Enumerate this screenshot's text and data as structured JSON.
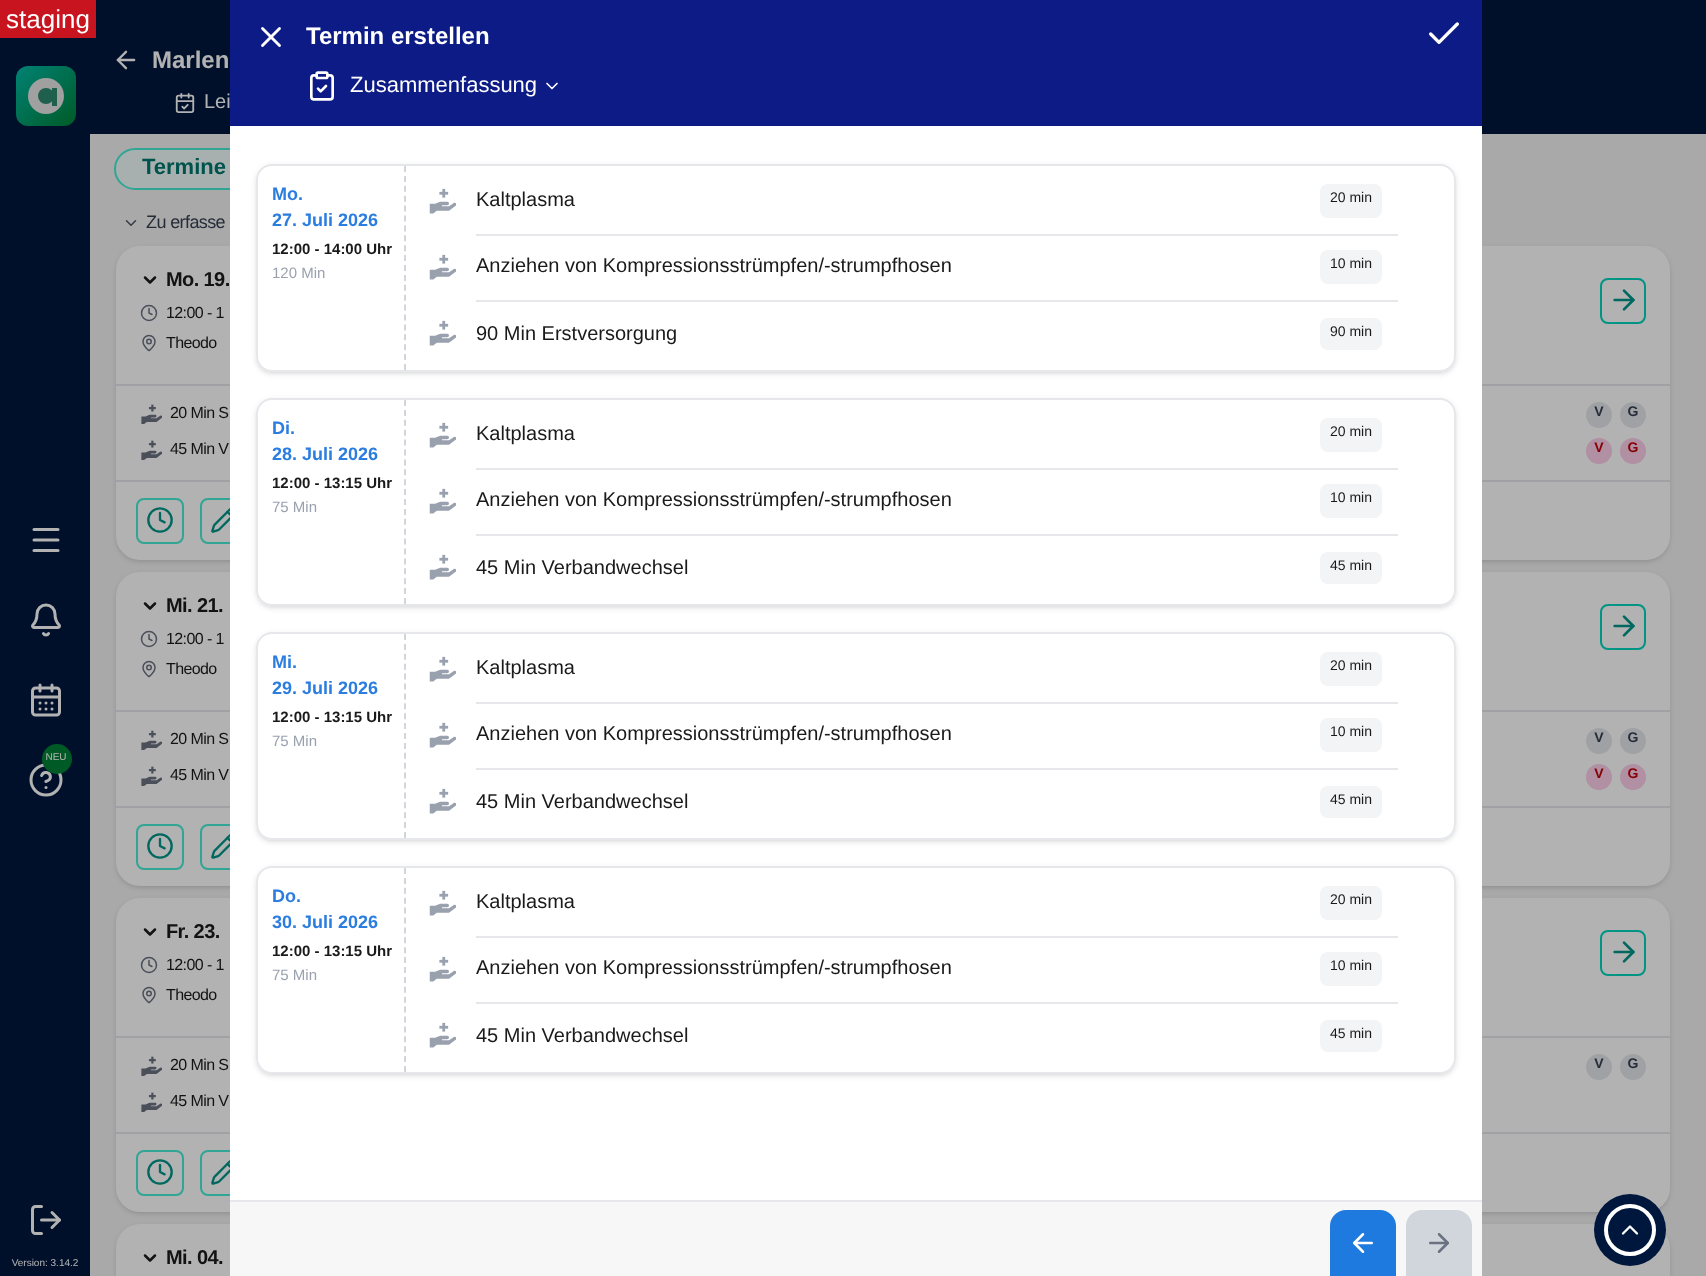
{
  "environment_badge": "staging",
  "sidebar": {
    "help_badge": "NEU",
    "version": "Version: 3.14.2"
  },
  "header": {
    "title": "Marlen",
    "subtitle": "Lei"
  },
  "tabs": [
    {
      "label": "Termine",
      "selected": true
    }
  ],
  "section": {
    "label": "Zu erfasse",
    "expanded": true
  },
  "appointments": [
    {
      "date": "Mo. 19.",
      "expanded": true,
      "time": "12:00 - 1",
      "place": "Theodo",
      "services": [
        {
          "label": "20 Min S",
          "badges": [
            {
              "label": "V",
              "alert": false
            },
            {
              "label": "G",
              "alert": false
            }
          ]
        },
        {
          "label": "45 Min V",
          "badges": [
            {
              "label": "V",
              "alert": true
            },
            {
              "label": "G",
              "alert": true
            }
          ]
        }
      ]
    },
    {
      "date": "Mi. 21.",
      "expanded": true,
      "time": "12:00 - 1",
      "place": "Theodo",
      "services": [
        {
          "label": "20 Min S",
          "badges": [
            {
              "label": "V",
              "alert": false
            },
            {
              "label": "G",
              "alert": false
            }
          ]
        },
        {
          "label": "45 Min V",
          "badges": [
            {
              "label": "V",
              "alert": true
            },
            {
              "label": "G",
              "alert": true
            }
          ]
        }
      ]
    },
    {
      "date": "Fr. 23.",
      "expanded": true,
      "time": "12:00 - 1",
      "place": "Theodo",
      "services": [
        {
          "label": "20 Min S",
          "badges": [
            {
              "label": "V",
              "alert": false
            },
            {
              "label": "G",
              "alert": false
            }
          ]
        },
        {
          "label": "45 Min V"
        }
      ]
    },
    {
      "date": "Mi. 04.",
      "expanded": true
    }
  ],
  "modal": {
    "title": "Termin erstellen",
    "step": "Zusammenfassung",
    "days": [
      {
        "weekday": "Mo.",
        "date": "27. Juli 2026",
        "time": "12:00 - 14:00 Uhr",
        "duration": "120 Min",
        "services": [
          {
            "label": "Kaltplasma",
            "minutes": "20 min"
          },
          {
            "label": "Anziehen von Kompressionsstrümpfen/-strumpfhosen",
            "minutes": "10 min"
          },
          {
            "label": "90 Min Erstversorgung",
            "minutes": "90 min"
          }
        ]
      },
      {
        "weekday": "Di.",
        "date": "28. Juli 2026",
        "time": "12:00 - 13:15 Uhr",
        "duration": "75 Min",
        "services": [
          {
            "label": "Kaltplasma",
            "minutes": "20 min"
          },
          {
            "label": "Anziehen von Kompressionsstrümpfen/-strumpfhosen",
            "minutes": "10 min"
          },
          {
            "label": "45 Min Verbandwechsel",
            "minutes": "45 min"
          }
        ]
      },
      {
        "weekday": "Mi.",
        "date": "29. Juli 2026",
        "time": "12:00 - 13:15 Uhr",
        "duration": "75 Min",
        "services": [
          {
            "label": "Kaltplasma",
            "minutes": "20 min"
          },
          {
            "label": "Anziehen von Kompressionsstrümpfen/-strumpfhosen",
            "minutes": "10 min"
          },
          {
            "label": "45 Min Verbandwechsel",
            "minutes": "45 min"
          }
        ]
      },
      {
        "weekday": "Do.",
        "date": "30. Juli 2026",
        "time": "12:00 - 13:15 Uhr",
        "duration": "75 Min",
        "services": [
          {
            "label": "Kaltplasma",
            "minutes": "20 min"
          },
          {
            "label": "Anziehen von Kompressionsstrümpfen/-strumpfhosen",
            "minutes": "10 min"
          },
          {
            "label": "45 Min Verbandwechsel",
            "minutes": "45 min"
          }
        ]
      }
    ],
    "back_button": {
      "disabled": false
    },
    "next_button": {
      "disabled": true
    }
  }
}
